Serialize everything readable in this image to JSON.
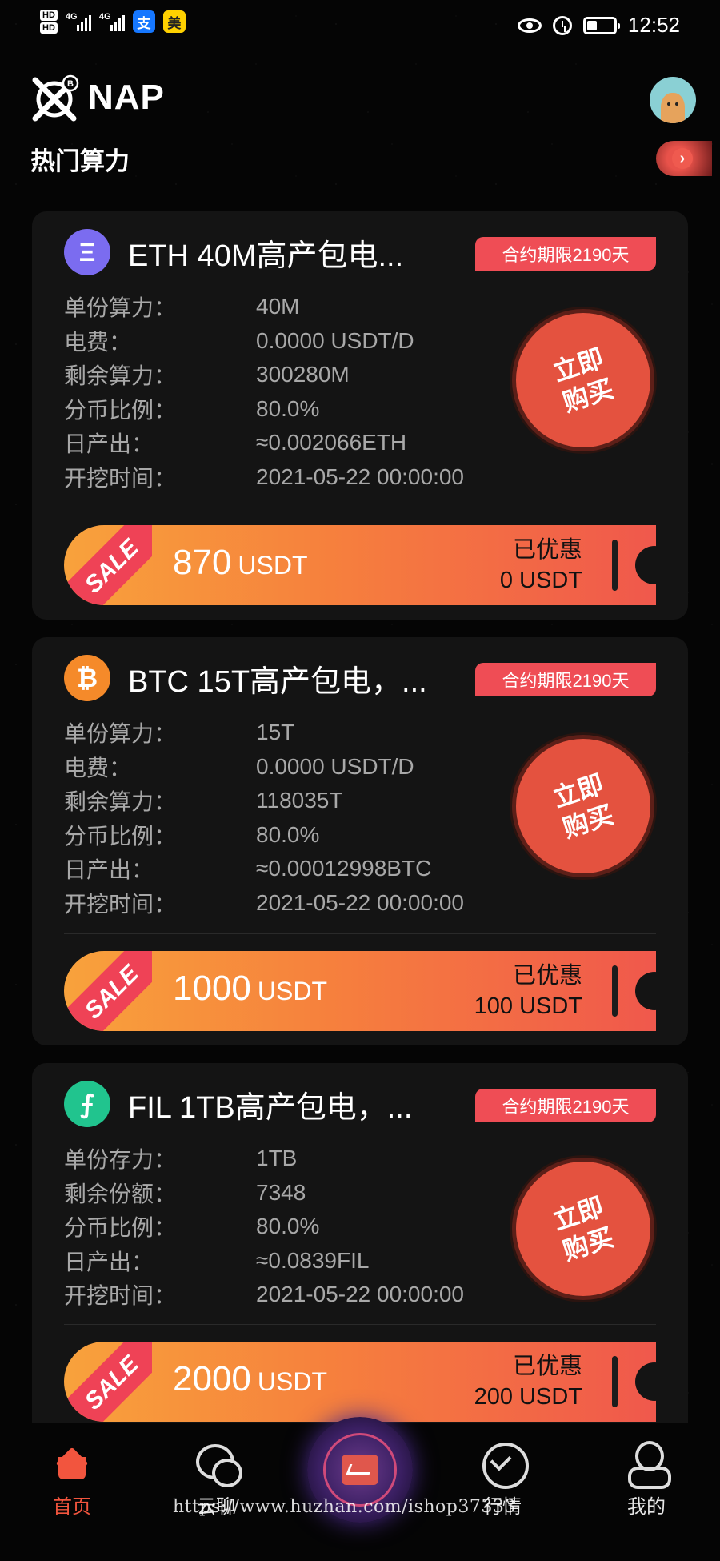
{
  "status_bar": {
    "hd1": "HD",
    "hd2": "HD",
    "net1": "4G",
    "net2": "4G",
    "app1": "支",
    "app2": "美",
    "time": "12:52"
  },
  "header": {
    "brand": "NAP",
    "section_title": "热门算力",
    "more": "›"
  },
  "products": [
    {
      "coin_symbol": "Ξ",
      "coin_color": "#7b6cf0",
      "title": "ETH 40M高产包电...",
      "term": "合约期限2190天",
      "rows": [
        {
          "key": "单份算力：",
          "value": "40M"
        },
        {
          "key": "电费：",
          "value": "0.0000 USDT/D"
        },
        {
          "key": "剩余算力：",
          "value": "300280M"
        },
        {
          "key": "分币比例：",
          "value": "80.0%"
        },
        {
          "key": "日产出：",
          "value": "≈0.002066ETH"
        },
        {
          "key": "开挖时间：",
          "value": "2021-05-22 00:00:00"
        }
      ],
      "buy_label": "立即购买",
      "sale": "SALE",
      "price": "870",
      "price_unit": "USDT",
      "discount_label": "已优惠",
      "discount_value": "0 USDT"
    },
    {
      "coin_symbol": "₿",
      "coin_color": "#f58a2a",
      "title": "BTC 15T高产包电，...",
      "term": "合约期限2190天",
      "rows": [
        {
          "key": "单份算力：",
          "value": "15T"
        },
        {
          "key": "电费：",
          "value": "0.0000 USDT/D"
        },
        {
          "key": "剩余算力：",
          "value": "118035T"
        },
        {
          "key": "分币比例：",
          "value": "80.0%"
        },
        {
          "key": "日产出：",
          "value": "≈0.00012998BTC"
        },
        {
          "key": "开挖时间：",
          "value": "2021-05-22 00:00:00"
        }
      ],
      "buy_label": "立即购买",
      "sale": "SALE",
      "price": "1000",
      "price_unit": "USDT",
      "discount_label": "已优惠",
      "discount_value": "100 USDT"
    },
    {
      "coin_symbol": "⨍",
      "coin_color": "#21c48e",
      "title": "FIL 1TB高产包电，...",
      "term": "合约期限2190天",
      "rows": [
        {
          "key": "单份存力：",
          "value": "1TB"
        },
        {
          "key": "剩余份额：",
          "value": "7348"
        },
        {
          "key": "分币比例：",
          "value": "80.0%"
        },
        {
          "key": "日产出：",
          "value": "≈0.0839FIL"
        },
        {
          "key": "开挖时间：",
          "value": "2021-05-22 00:00:00"
        }
      ],
      "buy_label": "立即购买",
      "sale": "SALE",
      "price": "2000",
      "price_unit": "USDT",
      "discount_label": "已优惠",
      "discount_value": "200 USDT"
    }
  ],
  "nav": {
    "home": "首页",
    "chat": "云聊",
    "market": "行情",
    "mine": "我的"
  },
  "watermark": "https://www.huzhan.com/ishop37333"
}
